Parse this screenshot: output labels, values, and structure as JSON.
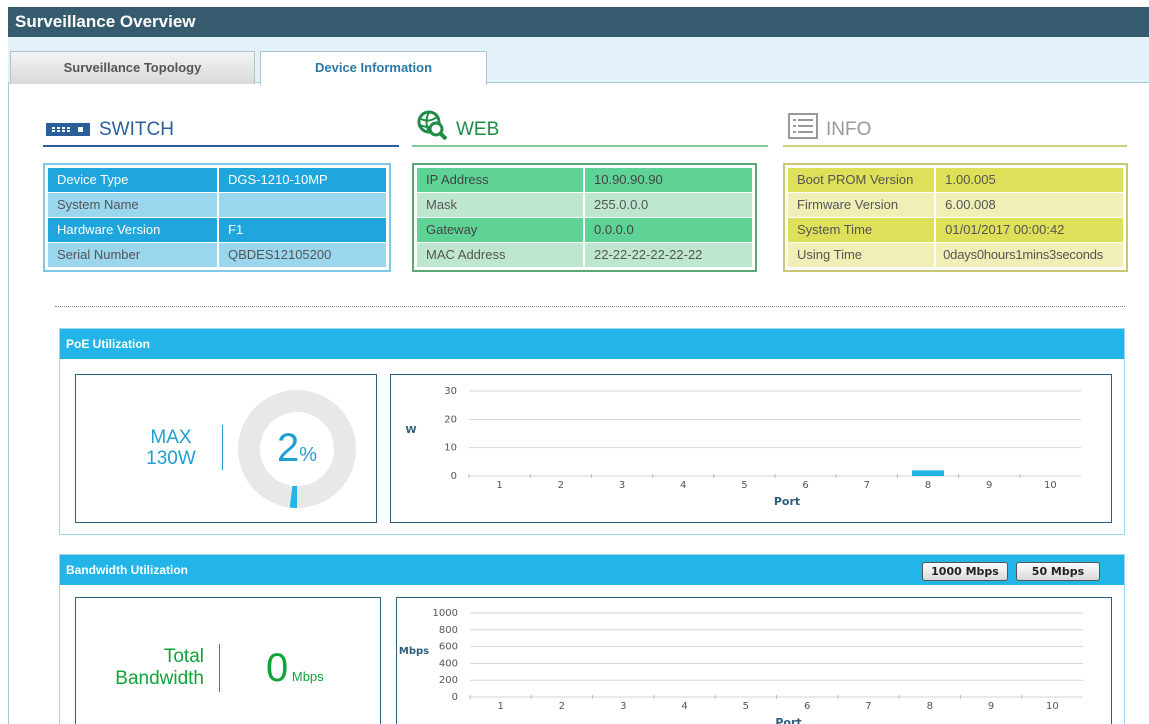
{
  "window": {
    "title": "Surveillance Overview"
  },
  "tabs": [
    {
      "label": "Surveillance Topology",
      "active": false
    },
    {
      "label": "Device Information",
      "active": true
    }
  ],
  "switch_section": {
    "title": "SWITCH",
    "icon": "switch-icon",
    "rows": [
      {
        "label": "Device Type",
        "value": "DGS-1210-10MP"
      },
      {
        "label": "System Name",
        "value": ""
      },
      {
        "label": "Hardware Version",
        "value": "F1"
      },
      {
        "label": "Serial Number",
        "value": "QBDES12105200"
      }
    ]
  },
  "web_section": {
    "title": "WEB",
    "icon": "globe-search-icon",
    "rows": [
      {
        "label": "IP Address",
        "value": "10.90.90.90"
      },
      {
        "label": "Mask",
        "value": "255.0.0.0"
      },
      {
        "label": "Gateway",
        "value": "0.0.0.0"
      },
      {
        "label": "MAC Address",
        "value": "22-22-22-22-22-22"
      }
    ]
  },
  "info_section": {
    "title": "INFO",
    "icon": "list-icon",
    "rows": [
      {
        "label": "Boot PROM Version",
        "value": "1.00.005"
      },
      {
        "label": "Firmware Version",
        "value": "6.00.008"
      },
      {
        "label": "System Time",
        "value": "01/01/2017 00:00:42"
      },
      {
        "label": "Using Time",
        "value": "0days0hours1mins3seconds"
      }
    ]
  },
  "poe": {
    "title": "PoE Utilization",
    "max_line1": "MAX",
    "max_line2": "130W",
    "percent_value": "2",
    "percent_sign": "%",
    "utilization_fraction": 0.02
  },
  "bandwidth": {
    "title": "Bandwidth Utilization",
    "buttons": [
      "1000 Mbps",
      "50 Mbps"
    ],
    "total_line1": "Total",
    "total_line2": "Bandwidth",
    "value": "0",
    "unit": "Mbps"
  },
  "colors": {
    "switch_dark": "#1fa6dc",
    "switch_light": "#9ad6ee",
    "switch_border": "#7ec8e6",
    "web_dark": "#5fd395",
    "web_light": "#bfe6cf",
    "web_border": "#5aa878",
    "info_dark": "#dfe05a",
    "info_light": "#efefb6",
    "info_border": "#c8c873",
    "accent": "#24b5e8",
    "green_text": "#12a339"
  },
  "chart_data": [
    {
      "type": "bar",
      "categories": [
        "1",
        "2",
        "3",
        "4",
        "5",
        "6",
        "7",
        "8",
        "9",
        "10"
      ],
      "values": [
        0,
        0,
        0,
        0,
        0,
        0,
        0,
        2,
        0,
        0
      ],
      "xlabel": "Port",
      "ylabel": "W",
      "ylim": [
        0,
        30
      ],
      "yticks": [
        "0",
        "10",
        "20",
        "30"
      ],
      "grid": true
    },
    {
      "type": "bar",
      "categories": [
        "1",
        "2",
        "3",
        "4",
        "5",
        "6",
        "7",
        "8",
        "9",
        "10"
      ],
      "values": [
        0,
        0,
        0,
        0,
        0,
        0,
        0,
        0,
        0,
        0
      ],
      "xlabel": "Port",
      "ylabel": "Mbps",
      "ylim": [
        0,
        1000
      ],
      "yticks": [
        "0",
        "200",
        "400",
        "600",
        "800",
        "1000"
      ],
      "grid": true
    }
  ]
}
